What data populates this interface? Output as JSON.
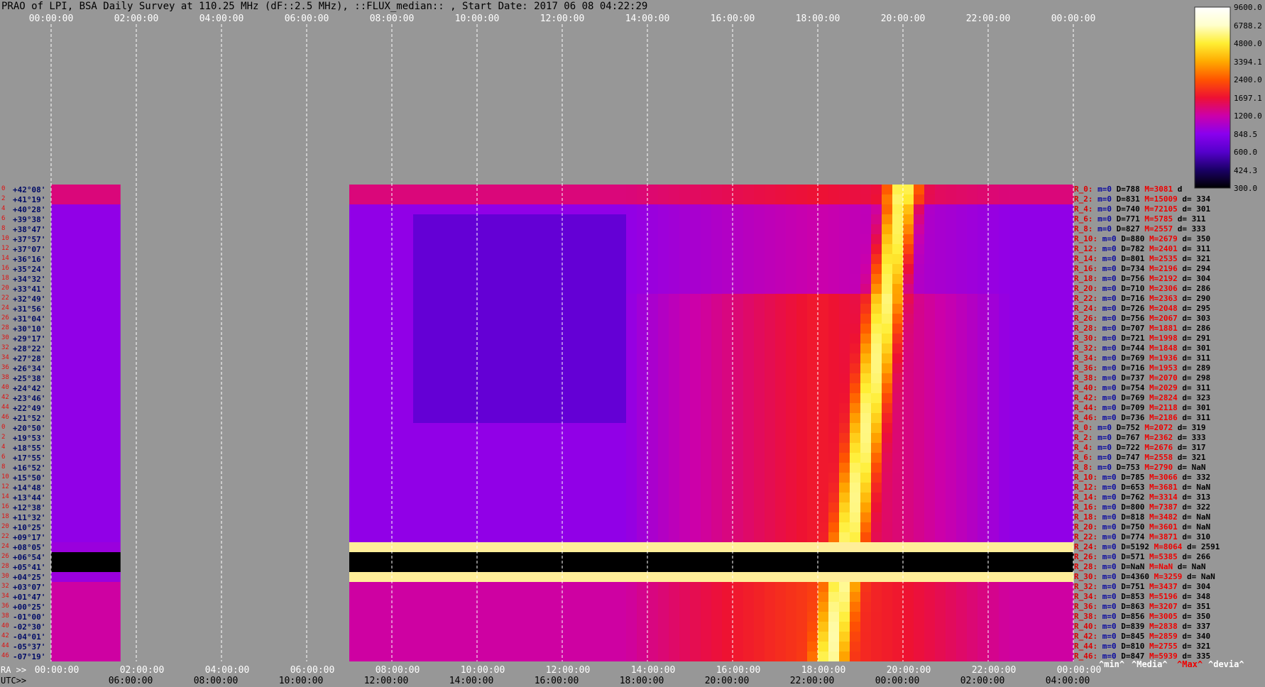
{
  "title": "PRAO of LPI, BSA Daily Survey at 110.25 MHz (dF::2.5 MHz), ::FLUX_median:: , Start Date: 2017 06 08 04:22:29",
  "axis": {
    "top_utc": [
      "00:00:00",
      "02:00:00",
      "04:00:00",
      "06:00:00",
      "08:00:00",
      "10:00:00",
      "12:00:00",
      "14:00:00",
      "16:00:00",
      "18:00:00",
      "20:00:00",
      "22:00:00",
      "00:00:00"
    ],
    "bottom_utc": [
      "00:00:00",
      "02:00:00",
      "04:00:00",
      "06:00:00",
      "08:00:00",
      "10:00:00",
      "12:00:00",
      "14:00:00",
      "16:00:00",
      "18:00:00",
      "20:00:00",
      "22:00:00",
      "00:00:00"
    ],
    "bottom_ra": [
      "06:00:00",
      "08:00:00",
      "10:00:00",
      "12:00:00",
      "14:00:00",
      "16:00:00",
      "18:00:00",
      "20:00:00",
      "22:00:00",
      "00:00:00",
      "02:00:00",
      "04:00:00"
    ],
    "ra_label": "RA >>",
    "utc_label": "UTC>>"
  },
  "declinations": [
    "+42°08'",
    "+41°19'",
    "+40°28'",
    "+39°38'",
    "+38°47'",
    "+37°57'",
    "+37°07'",
    "+36°16'",
    "+35°24'",
    "+34°32'",
    "+33°41'",
    "+32°49'",
    "+31°56'",
    "+31°04'",
    "+30°10'",
    "+29°17'",
    "+28°22'",
    "+27°28'",
    "+26°34'",
    "+25°38'",
    "+24°42'",
    "+23°46'",
    "+22°49'",
    "+21°52'",
    "+20°50'",
    "+19°53'",
    "+18°55'",
    "+17°55'",
    "+16°52'",
    "+15°50'",
    "+14°48'",
    "+13°44'",
    "+12°38'",
    "+11°32'",
    "+10°25'",
    "+09°17'",
    "+08°05'",
    "+06°54'",
    "+05°41'",
    "+04°25'",
    "+03°07'",
    "+01°47'",
    "+00°25'",
    "-01°00'",
    "-02°30'",
    "-04°01'",
    "-05°37'",
    "-07°19'"
  ],
  "row_index": [
    "0",
    "2",
    "4",
    "6",
    "8",
    "10",
    "12",
    "14",
    "16",
    "18",
    "20",
    "22",
    "24",
    "26",
    "28",
    "30",
    "32",
    "34",
    "36",
    "38",
    "40",
    "42",
    "44",
    "46",
    "0",
    "2",
    "4",
    "6",
    "8",
    "10",
    "12",
    "14",
    "16",
    "18",
    "20",
    "22",
    "24",
    "26",
    "28",
    "30",
    "32",
    "34",
    "36",
    "38",
    "40",
    "42",
    "44",
    "46"
  ],
  "stats": [
    {
      "r": "R_0:",
      "m": "m=0",
      "D": "D=788",
      "M": "M=3081",
      "d": "d"
    },
    {
      "r": "R_2:",
      "m": "m=0",
      "D": "D=831",
      "M": "M=15009",
      "d": "d= 334"
    },
    {
      "r": "R_4:",
      "m": "m=0",
      "D": "D=740",
      "M": "M=72105",
      "d": "d= 301"
    },
    {
      "r": "R_6:",
      "m": "m=0",
      "D": "D=771",
      "M": "M=5785",
      "d": "d= 311"
    },
    {
      "r": "R_8:",
      "m": "m=0",
      "D": "D=827",
      "M": "M=2557",
      "d": "d= 333"
    },
    {
      "r": "R_10:",
      "m": "m=0",
      "D": "D=880",
      "M": "M=2679",
      "d": "d= 350"
    },
    {
      "r": "R_12:",
      "m": "m=0",
      "D": "D=782",
      "M": "M=2401",
      "d": "d= 311"
    },
    {
      "r": "R_14:",
      "m": "m=0",
      "D": "D=801",
      "M": "M=2535",
      "d": "d= 321"
    },
    {
      "r": "R_16:",
      "m": "m=0",
      "D": "D=734",
      "M": "M=2196",
      "d": "d= 294"
    },
    {
      "r": "R_18:",
      "m": "m=0",
      "D": "D=756",
      "M": "M=2192",
      "d": "d= 304"
    },
    {
      "r": "R_20:",
      "m": "m=0",
      "D": "D=710",
      "M": "M=2306",
      "d": "d= 286"
    },
    {
      "r": "R_22:",
      "m": "m=0",
      "D": "D=716",
      "M": "M=2363",
      "d": "d= 290"
    },
    {
      "r": "R_24:",
      "m": "m=0",
      "D": "D=726",
      "M": "M=2048",
      "d": "d= 295"
    },
    {
      "r": "R_26:",
      "m": "m=0",
      "D": "D=756",
      "M": "M=2067",
      "d": "d= 303"
    },
    {
      "r": "R_28:",
      "m": "m=0",
      "D": "D=707",
      "M": "M=1881",
      "d": "d= 286"
    },
    {
      "r": "R_30:",
      "m": "m=0",
      "D": "D=721",
      "M": "M=1998",
      "d": "d= 291"
    },
    {
      "r": "R_32:",
      "m": "m=0",
      "D": "D=744",
      "M": "M=1848",
      "d": "d= 301"
    },
    {
      "r": "R_34:",
      "m": "m=0",
      "D": "D=769",
      "M": "M=1936",
      "d": "d= 311"
    },
    {
      "r": "R_36:",
      "m": "m=0",
      "D": "D=716",
      "M": "M=1953",
      "d": "d= 289"
    },
    {
      "r": "R_38:",
      "m": "m=0",
      "D": "D=737",
      "M": "M=2070",
      "d": "d= 298"
    },
    {
      "r": "R_40:",
      "m": "m=0",
      "D": "D=754",
      "M": "M=2029",
      "d": "d= 311"
    },
    {
      "r": "R_42:",
      "m": "m=0",
      "D": "D=769",
      "M": "M=2824",
      "d": "d= 323"
    },
    {
      "r": "R_44:",
      "m": "m=0",
      "D": "D=709",
      "M": "M=2118",
      "d": "d= 301"
    },
    {
      "r": "R_46:",
      "m": "m=0",
      "D": "D=736",
      "M": "M=2186",
      "d": "d= 311"
    },
    {
      "r": "R_0:",
      "m": "m=0",
      "D": "D=752",
      "M": "M=2072",
      "d": "d= 319"
    },
    {
      "r": "R_2:",
      "m": "m=0",
      "D": "D=767",
      "M": "M=2362",
      "d": "d= 333"
    },
    {
      "r": "R_4:",
      "m": "m=0",
      "D": "D=722",
      "M": "M=2676",
      "d": "d= 317"
    },
    {
      "r": "R_6:",
      "m": "m=0",
      "D": "D=747",
      "M": "M=2558",
      "d": "d= 321"
    },
    {
      "r": "R_8:",
      "m": "m=0",
      "D": "D=753",
      "M": "M=2790",
      "d": "d= NaN"
    },
    {
      "r": "R_10:",
      "m": "m=0",
      "D": "D=785",
      "M": "M=3066",
      "d": "d= 332"
    },
    {
      "r": "R_12:",
      "m": "m=0",
      "D": "D=653",
      "M": "M=3681",
      "d": "d= NaN"
    },
    {
      "r": "R_14:",
      "m": "m=0",
      "D": "D=762",
      "M": "M=3314",
      "d": "d= 313"
    },
    {
      "r": "R_16:",
      "m": "m=0",
      "D": "D=800",
      "M": "M=7387",
      "d": "d= 322"
    },
    {
      "r": "R_18:",
      "m": "m=0",
      "D": "D=818",
      "M": "M=3482",
      "d": "d= NaN"
    },
    {
      "r": "R_20:",
      "m": "m=0",
      "D": "D=750",
      "M": "M=3601",
      "d": "d= NaN"
    },
    {
      "r": "R_22:",
      "m": "m=0",
      "D": "D=774",
      "M": "M=3871",
      "d": "d= 310"
    },
    {
      "r": "R_24:",
      "m": "m=0",
      "D": "D=5192",
      "M": "M=8064",
      "d": "d= 2591"
    },
    {
      "r": "R_26:",
      "m": "m=0",
      "D": "D=571",
      "M": "M=5385",
      "d": "d= 266"
    },
    {
      "r": "R_28:",
      "m": "m=0",
      "D": "D=NaN",
      "M": "M=NaN",
      "d": "d= NaN"
    },
    {
      "r": "R_30:",
      "m": "m=0",
      "D": "D=4360",
      "M": "M=3259",
      "d": "d= NaN"
    },
    {
      "r": "R_32:",
      "m": "m=0",
      "D": "D=751",
      "M": "M=3437",
      "d": "d= 304"
    },
    {
      "r": "R_34:",
      "m": "m=0",
      "D": "D=853",
      "M": "M=5196",
      "d": "d= 348"
    },
    {
      "r": "R_36:",
      "m": "m=0",
      "D": "D=863",
      "M": "M=3207",
      "d": "d= 351"
    },
    {
      "r": "R_38:",
      "m": "m=0",
      "D": "D=856",
      "M": "M=3005",
      "d": "d= 350"
    },
    {
      "r": "R_40:",
      "m": "m=0",
      "D": "D=839",
      "M": "M=2838",
      "d": "d= 337"
    },
    {
      "r": "R_42:",
      "m": "m=0",
      "D": "D=845",
      "M": "M=2859",
      "d": "d= 340"
    },
    {
      "r": "R_44:",
      "m": "m=0",
      "D": "D=810",
      "M": "M=2755",
      "d": "d= 321"
    },
    {
      "r": "R_46:",
      "m": "m=0",
      "D": "D=847",
      "M": "M=5939",
      "d": "d= 335"
    }
  ],
  "legend": {
    "min": "^min^",
    "median": "^Media^",
    "max": "^Max^",
    "dev": "^devia^"
  },
  "colorbar": {
    "ticks": [
      "9600.0",
      "6788.2",
      "4800.0",
      "3394.1",
      "2400.0",
      "1697.1",
      "1200.0",
      "848.5",
      "600.0",
      "424.3",
      "300.0"
    ]
  },
  "chart_data": {
    "type": "heatmap",
    "title": "PRAO of LPI, BSA Daily Survey at 110.25 MHz (dF::2.5 MHz), ::FLUX_median:: , Start Date: 2017 06 08 04:22:29",
    "x_utc_hours_range": [
      0,
      24
    ],
    "y": "declination beams (48 rows)",
    "colorscale": [
      "#000000",
      "#1a0066",
      "#5500cc",
      "#8a00ee",
      "#cc00aa",
      "#ee1133",
      "#ff5500",
      "#ffaa00",
      "#ffee33",
      "#ffffcc",
      "#ffffff"
    ],
    "color_range": [
      300.0,
      9600.0
    ],
    "data_segments_utc_hours": [
      [
        0.0,
        1.62
      ],
      [
        7.0,
        24.0
      ]
    ],
    "features": [
      {
        "label": "bright diagonal source track",
        "utc_start_h": 20.0,
        "row_start": 0,
        "utc_end_h": 18.3,
        "row_end": 47
      },
      {
        "label": "saturated/zero rows",
        "rows": [
          36,
          37,
          38,
          39
        ]
      }
    ]
  }
}
